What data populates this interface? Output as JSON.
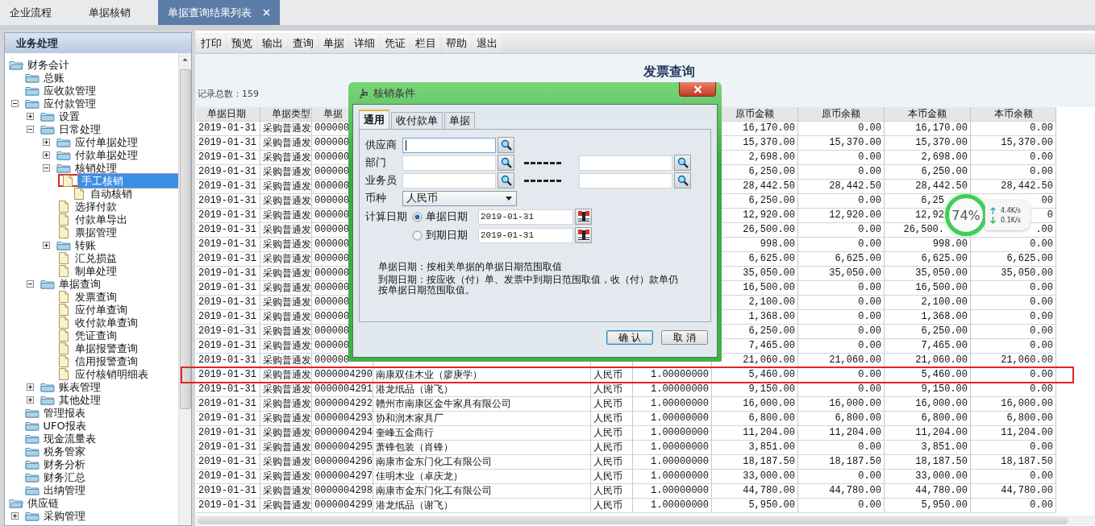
{
  "tabs": [
    {
      "label": "企业流程",
      "selected": false,
      "closable": false
    },
    {
      "label": "单据核销",
      "selected": false,
      "closable": false
    },
    {
      "label": "单据查询结果列表",
      "selected": true,
      "closable": true
    }
  ],
  "sidebar": {
    "title": "业务处理",
    "tree": [
      {
        "label": "财务会计",
        "kind": "folder",
        "selected": false,
        "annotated": false,
        "expanded": true,
        "children": [
          {
            "label": "总账",
            "kind": "folder",
            "selected": false,
            "annotated": false
          },
          {
            "label": "应收款管理",
            "kind": "folder",
            "selected": false,
            "annotated": false
          },
          {
            "label": "应付款管理",
            "kind": "folder",
            "selected": false,
            "annotated": false,
            "expanded": true,
            "children": [
              {
                "label": "设置",
                "kind": "folder",
                "selected": false,
                "annotated": false,
                "expanded": false
              },
              {
                "label": "日常处理",
                "kind": "folder",
                "selected": false,
                "annotated": false,
                "expanded": true,
                "children": [
                  {
                    "label": "应付单据处理",
                    "kind": "folder",
                    "selected": false,
                    "annotated": false,
                    "expanded": false
                  },
                  {
                    "label": "付款单据处理",
                    "kind": "folder",
                    "selected": false,
                    "annotated": false,
                    "expanded": false
                  },
                  {
                    "label": "核销处理",
                    "kind": "folder",
                    "selected": false,
                    "annotated": false,
                    "expanded": true,
                    "children": [
                      {
                        "label": "手工核销",
                        "kind": "doc",
                        "selected": true,
                        "annotated": true
                      },
                      {
                        "label": "自动核销",
                        "kind": "doc",
                        "selected": false,
                        "annotated": false
                      }
                    ]
                  },
                  {
                    "label": "选择付款",
                    "kind": "doc",
                    "selected": false,
                    "annotated": false
                  },
                  {
                    "label": "付款单导出",
                    "kind": "doc",
                    "selected": false,
                    "annotated": false
                  },
                  {
                    "label": "票据管理",
                    "kind": "doc",
                    "selected": false,
                    "annotated": false
                  },
                  {
                    "label": "转账",
                    "kind": "folder",
                    "selected": false,
                    "annotated": false,
                    "expanded": false
                  },
                  {
                    "label": "汇兑损益",
                    "kind": "doc",
                    "selected": false,
                    "annotated": false
                  },
                  {
                    "label": "制单处理",
                    "kind": "doc",
                    "selected": false,
                    "annotated": false
                  }
                ]
              },
              {
                "label": "单据查询",
                "kind": "folder",
                "selected": false,
                "annotated": false,
                "expanded": true,
                "children": [
                  {
                    "label": "发票查询",
                    "kind": "doc",
                    "selected": false,
                    "annotated": false
                  },
                  {
                    "label": "应付单查询",
                    "kind": "doc",
                    "selected": false,
                    "annotated": false
                  },
                  {
                    "label": "收付款单查询",
                    "kind": "doc",
                    "selected": false,
                    "annotated": false
                  },
                  {
                    "label": "凭证查询",
                    "kind": "doc",
                    "selected": false,
                    "annotated": false
                  },
                  {
                    "label": "单据报警查询",
                    "kind": "doc",
                    "selected": false,
                    "annotated": false
                  },
                  {
                    "label": "信用报警查询",
                    "kind": "doc",
                    "selected": false,
                    "annotated": false
                  },
                  {
                    "label": "应付核销明细表",
                    "kind": "doc",
                    "selected": false,
                    "annotated": false
                  }
                ]
              },
              {
                "label": "账表管理",
                "kind": "folder",
                "selected": false,
                "annotated": false,
                "expanded": false
              },
              {
                "label": "其他处理",
                "kind": "folder",
                "selected": false,
                "annotated": false,
                "expanded": false
              }
            ]
          },
          {
            "label": "管理报表",
            "kind": "folder",
            "selected": false,
            "annotated": false
          },
          {
            "label": "UFO报表",
            "kind": "folder",
            "selected": false,
            "annotated": false
          },
          {
            "label": "现金流量表",
            "kind": "folder",
            "selected": false,
            "annotated": false
          },
          {
            "label": "税务管家",
            "kind": "folder",
            "selected": false,
            "annotated": false
          },
          {
            "label": "财务分析",
            "kind": "folder",
            "selected": false,
            "annotated": false
          },
          {
            "label": "财务汇总",
            "kind": "folder",
            "selected": false,
            "annotated": false
          },
          {
            "label": "出纳管理",
            "kind": "folder",
            "selected": false,
            "annotated": false
          }
        ]
      },
      {
        "label": "供应链",
        "kind": "folder",
        "selected": false,
        "annotated": false,
        "expanded": true,
        "children": [
          {
            "label": "采购管理",
            "kind": "folder",
            "selected": false,
            "annotated": false,
            "expanded": false
          }
        ]
      }
    ]
  },
  "toolbar": [
    "打印",
    "预览",
    "输出",
    "查询",
    "单据",
    "详细",
    "凭证",
    "栏目",
    "帮助",
    "退出"
  ],
  "report": {
    "title": "发票查询",
    "record_count": "记录总数：159"
  },
  "table": {
    "columns": [
      "单据日期",
      "单据类型",
      "单据",
      null,
      null,
      null,
      "原币金额",
      "原币余额",
      "本币金额",
      "本币余额"
    ],
    "rows": [
      {
        "annotated": false,
        "cells": [
          "2019-01-31",
          "采购普通发",
          "000000",
          null,
          null,
          null,
          "16,170.00",
          "0.00",
          "16,170.00",
          "0.00"
        ]
      },
      {
        "annotated": false,
        "cells": [
          "2019-01-31",
          "采购普通发",
          "000000",
          null,
          null,
          null,
          "15,370.00",
          "15,370.00",
          "15,370.00",
          "15,370.00"
        ]
      },
      {
        "annotated": false,
        "cells": [
          "2019-01-31",
          "采购普通发",
          "000000",
          null,
          null,
          null,
          "2,698.00",
          "0.00",
          "2,698.00",
          "0.00"
        ]
      },
      {
        "annotated": false,
        "cells": [
          "2019-01-31",
          "采购普通发",
          "000000",
          null,
          null,
          null,
          "6,250.00",
          "0.00",
          "6,250.00",
          "0.00"
        ]
      },
      {
        "annotated": false,
        "cells": [
          "2019-01-31",
          "采购普通发",
          "000000",
          null,
          null,
          null,
          "28,442.50",
          "28,442.50",
          "28,442.50",
          "28,442.50"
        ]
      },
      {
        "annotated": false,
        "cells": [
          "2019-01-31",
          "采购普通发",
          "000000",
          null,
          null,
          null,
          "6,250.00",
          "0.00",
          {
            "text": "6,25",
            "covered": true
          },
          "00"
        ]
      },
      {
        "annotated": false,
        "cells": [
          "2019-01-31",
          "采购普通发",
          "000000",
          null,
          null,
          null,
          "12,920.00",
          "12,920.00",
          {
            "text": "12,92",
            "covered": true
          },
          "0"
        ]
      },
      {
        "annotated": false,
        "cells": [
          "2019-01-31",
          "采购普通发",
          "000000",
          null,
          null,
          null,
          "26,500.00",
          "0.00",
          {
            "text": "26,500.",
            "covered": true
          },
          ".00"
        ]
      },
      {
        "annotated": false,
        "cells": [
          "2019-01-31",
          "采购普通发",
          "000000",
          null,
          null,
          null,
          "998.00",
          "0.00",
          "998.00",
          "0.00"
        ]
      },
      {
        "annotated": false,
        "cells": [
          "2019-01-31",
          "采购普通发",
          "000000",
          null,
          null,
          null,
          "6,625.00",
          "6,625.00",
          "6,625.00",
          "6,625.00"
        ]
      },
      {
        "annotated": false,
        "cells": [
          "2019-01-31",
          "采购普通发",
          "000000",
          null,
          null,
          null,
          "35,050.00",
          "35,050.00",
          "35,050.00",
          "35,050.00"
        ]
      },
      {
        "annotated": false,
        "cells": [
          "2019-01-31",
          "采购普通发",
          "000000",
          null,
          null,
          null,
          "16,500.00",
          "0.00",
          "16,500.00",
          "0.00"
        ]
      },
      {
        "annotated": false,
        "cells": [
          "2019-01-31",
          "采购普通发",
          "000000",
          null,
          null,
          null,
          "2,100.00",
          "0.00",
          "2,100.00",
          "0.00"
        ]
      },
      {
        "annotated": false,
        "cells": [
          "2019-01-31",
          "采购普通发",
          "000000",
          null,
          null,
          null,
          "1,368.00",
          "0.00",
          "1,368.00",
          "0.00"
        ]
      },
      {
        "annotated": false,
        "cells": [
          "2019-01-31",
          "采购普通发",
          "000000",
          null,
          null,
          null,
          "6,250.00",
          "0.00",
          "6,250.00",
          "0.00"
        ]
      },
      {
        "annotated": false,
        "cells": [
          "2019-01-31",
          "采购普通发",
          "000000",
          null,
          null,
          null,
          "7,465.00",
          "0.00",
          "7,465.00",
          "0.00"
        ]
      },
      {
        "annotated": false,
        "cells": [
          "2019-01-31",
          "采购普通发",
          "000000",
          null,
          null,
          null,
          "21,060.00",
          "21,060.00",
          "21,060.00",
          "21,060.00"
        ]
      },
      {
        "annotated": true,
        "cells": [
          "2019-01-31",
          "采购普通发",
          "0000004290",
          "南康双佳木业（廖庚学）",
          "人民币",
          "1.00000000",
          "5,460.00",
          "0.00",
          "5,460.00",
          "0.00"
        ]
      },
      {
        "annotated": false,
        "cells": [
          "2019-01-31",
          "采购普通发",
          "0000004291",
          "港龙纸品（谢飞）",
          "人民币",
          "1.00000000",
          "9,150.00",
          "0.00",
          "9,150.00",
          "0.00"
        ]
      },
      {
        "annotated": false,
        "cells": [
          "2019-01-31",
          "采购普通发",
          "0000004292",
          "赣州市南康区金牛家具有限公司",
          "人民币",
          "1.00000000",
          "16,000.00",
          "16,000.00",
          "16,000.00",
          "16,000.00"
        ]
      },
      {
        "annotated": false,
        "cells": [
          "2019-01-31",
          "采购普通发",
          "0000004293",
          "协和润木家具厂",
          "人民币",
          "1.00000000",
          "6,800.00",
          "6,800.00",
          "6,800.00",
          "6,800.00"
        ]
      },
      {
        "annotated": false,
        "cells": [
          "2019-01-31",
          "采购普通发",
          "0000004294",
          "奎峰五金商行",
          "人民币",
          "1.00000000",
          "11,204.00",
          "11,204.00",
          "11,204.00",
          "11,204.00"
        ]
      },
      {
        "annotated": false,
        "cells": [
          "2019-01-31",
          "采购普通发",
          "0000004295",
          "萧锋包装（肖锋）",
          "人民币",
          "1.00000000",
          "3,851.00",
          "0.00",
          "3,851.00",
          "0.00"
        ]
      },
      {
        "annotated": false,
        "cells": [
          "2019-01-31",
          "采购普通发",
          "0000004296",
          "南康市金东门化工有限公司",
          "人民币",
          "1.00000000",
          "18,187.50",
          "18,187.50",
          "18,187.50",
          "18,187.50"
        ]
      },
      {
        "annotated": false,
        "cells": [
          "2019-01-31",
          "采购普通发",
          "0000004297",
          "佳明木业（卓庆龙）",
          "人民币",
          "1.00000000",
          "33,000.00",
          "0.00",
          "33,000.00",
          "0.00"
        ]
      },
      {
        "annotated": false,
        "cells": [
          "2019-01-31",
          "采购普通发",
          "0000004298",
          "南康市金东门化工有限公司",
          "人民币",
          "1.00000000",
          "44,780.00",
          "44,780.00",
          "44,780.00",
          "44,780.00"
        ]
      },
      {
        "annotated": false,
        "cells": [
          "2019-01-31",
          "采购普通发",
          "0000004299",
          "港龙纸品（谢飞）",
          "人民币",
          "1.00000000",
          "5,950.00",
          "0.00",
          "5,950.00",
          "0.00"
        ]
      }
    ]
  },
  "dialog": {
    "title": "核销条件",
    "tabs": [
      {
        "label": "通用",
        "selected": true
      },
      {
        "label": "收付款单",
        "selected": false
      },
      {
        "label": "单据",
        "selected": false
      }
    ],
    "fields": [
      {
        "label": "供应商",
        "kind": "lookup",
        "focused": true
      },
      {
        "label": "部门",
        "kind": "range",
        "focused": false
      },
      {
        "label": "业务员",
        "kind": "range",
        "focused": false
      },
      {
        "label": "币种",
        "kind": "select",
        "focused": false,
        "value": "人民币"
      }
    ],
    "date_label": "计算日期",
    "date_options": [
      {
        "label": "单据日期",
        "selected": true,
        "value": "2019-01-31"
      },
      {
        "label": "到期日期",
        "selected": false,
        "value": "2019-01-31"
      }
    ],
    "notes": [
      "单据日期：按相关单据的单据日期范围取值",
      "到期日期：按应收（付）单、发票中到期日范围取值，收（付）款单仍按单据日期范围取值。"
    ],
    "buttons": [
      {
        "label": "确 认",
        "default": true
      },
      {
        "label": "取 消",
        "default": false
      }
    ]
  },
  "speed_widget": {
    "percent": "74%",
    "upload": "4.4K/s",
    "download": "0.1K/s"
  }
}
